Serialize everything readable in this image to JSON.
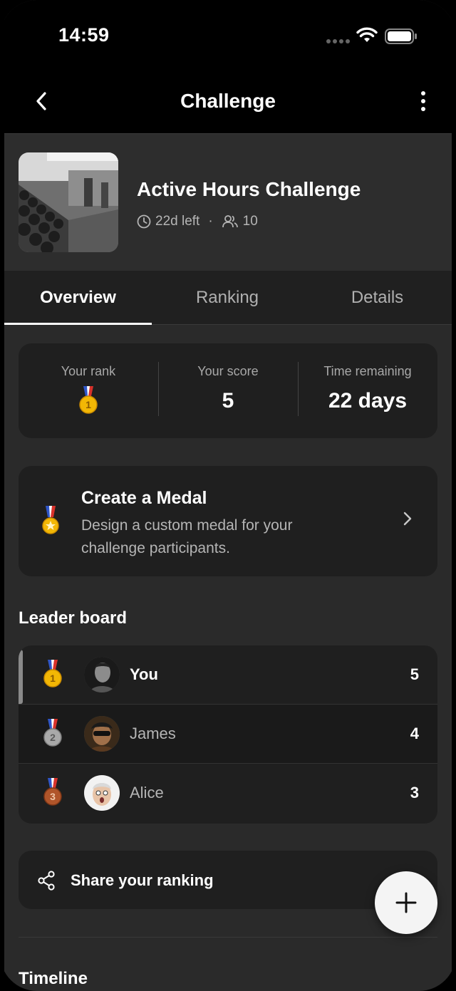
{
  "status_bar": {
    "time": "14:59"
  },
  "header": {
    "title": "Challenge"
  },
  "challenge": {
    "title": "Active Hours Challenge",
    "time_left": "22d left",
    "separator": "·",
    "participants": "10"
  },
  "tabs": [
    {
      "label": "Overview",
      "active": true
    },
    {
      "label": "Ranking",
      "active": false
    },
    {
      "label": "Details",
      "active": false
    }
  ],
  "stats": {
    "rank_label": "Your rank",
    "rank_value": "1",
    "score_label": "Your score",
    "score_value": "5",
    "time_label": "Time remaining",
    "time_value": "22 days"
  },
  "medal_card": {
    "title": "Create a Medal",
    "description": "Design a custom medal for your challenge participants."
  },
  "leaderboard": {
    "title": "Leader board",
    "rows": [
      {
        "rank": "1",
        "name": "You",
        "score": "5"
      },
      {
        "rank": "2",
        "name": "James",
        "score": "4"
      },
      {
        "rank": "3",
        "name": "Alice",
        "score": "3"
      }
    ]
  },
  "share": {
    "label": "Share your ranking"
  },
  "timeline": {
    "title": "Timeline"
  },
  "colors": {
    "gold": "#f2b705",
    "silver": "#a9a9a9",
    "bronze": "#b0552a",
    "ribbon_red": "#d8322b",
    "ribbon_blue": "#2f56c9"
  }
}
